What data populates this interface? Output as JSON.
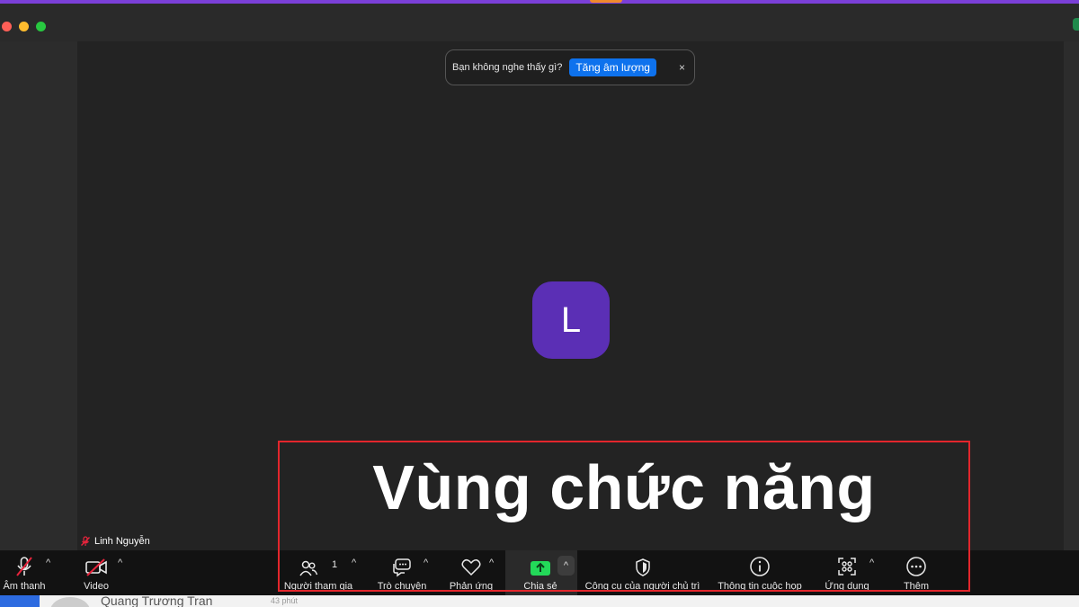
{
  "notice": {
    "text": "Bạn không nghe thấy gì?",
    "button": "Tăng âm lượng",
    "close": "×"
  },
  "avatar": {
    "initial": "L",
    "color": "#5b2fb5"
  },
  "annotation": {
    "text": "Vùng chức năng",
    "border_color": "#e3262c"
  },
  "participant": {
    "name": "Linh Nguyễn",
    "mic_status": "muted-mic-icon"
  },
  "toolbar": {
    "audio": "Âm thanh",
    "video": "Video",
    "participants": "Người tham gia",
    "participants_count": "1",
    "chat": "Trò chuyện",
    "reactions": "Phản ứng",
    "share": "Chia sẻ",
    "host_tools": "Công cụ của người chủ trì",
    "meeting_info": "Thông tin cuộc họp",
    "apps": "Ứng dụng",
    "more": "Thêm",
    "caret": "^"
  },
  "colors": {
    "accent": "#7b3fd8",
    "share_green": "#23d959",
    "button_blue": "#0e72ed",
    "muted_red": "#e8243c"
  },
  "background_app": {
    "name": "Quang Trương Tran",
    "time": "43 phút"
  }
}
